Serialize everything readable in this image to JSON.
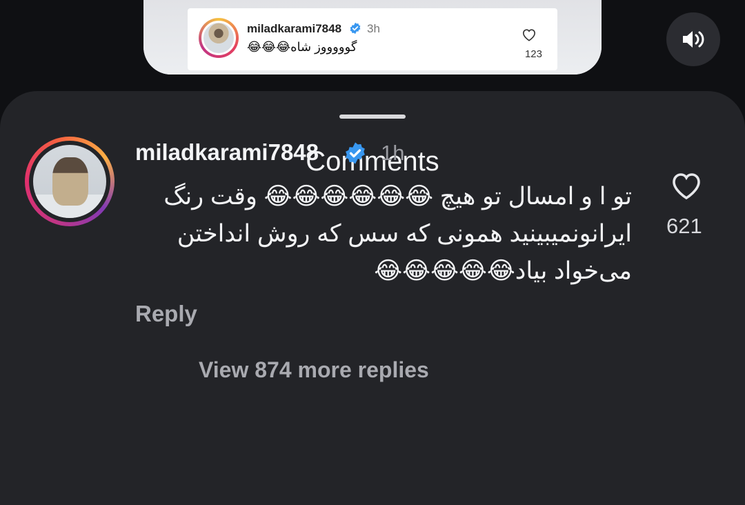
{
  "top_card": {
    "username": "miladkarami7848",
    "time": "3h",
    "text": "گوووووز شاه😂😂😂",
    "likes": "123"
  },
  "mute_button": {
    "icon": "speaker-icon"
  },
  "sheet": {
    "title": "Comments"
  },
  "comment": {
    "username": "miladkarami7848",
    "time": "1h",
    "text": "تو ا و امسال تو هیچ 😂😂😂😂😂😂 وقت رنگ ایرانونمیبینید  همونی که سس که روش انداختن می‌خواد بیاد😂😂😂😂😂",
    "likes": "621",
    "reply_label": "Reply",
    "view_replies_label": "View 874 more replies"
  },
  "colors": {
    "sheet_bg": "#232428",
    "page_bg": "#0f1013",
    "verified": "#3897f0",
    "muted_text": "#a9aab0"
  }
}
